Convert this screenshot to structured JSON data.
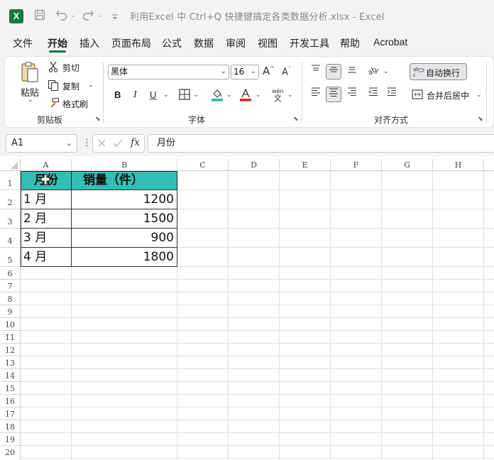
{
  "titlebar": {
    "logo": "X",
    "title": "利用Excel 中 Ctrl+Q 快捷键搞定各类数据分析.xlsx  -  Excel"
  },
  "menu": {
    "tabs": [
      "文件",
      "开始",
      "插入",
      "页面布局",
      "公式",
      "数据",
      "审阅",
      "视图",
      "开发工具",
      "帮助",
      "Acrobat"
    ],
    "active": "开始"
  },
  "clipboard": {
    "paste": "粘贴",
    "cut": "剪切",
    "copy": "复制",
    "format_painter": "格式刷",
    "group_label": "剪贴板"
  },
  "font": {
    "font_name": "黑体",
    "font_size": "16",
    "bold": "B",
    "italic": "I",
    "underline": "U",
    "pinyin": "wén",
    "group_label": "字体",
    "fill_color": "#2bb7a9",
    "font_color": "#e0201b"
  },
  "alignment": {
    "wrap_text": "自动换行",
    "merge_center": "合并后居中",
    "group_label": "对齐方式"
  },
  "formula_bar": {
    "name_box": "A1",
    "fx": "fx",
    "content": "月份"
  },
  "sheet": {
    "columns": [
      "A",
      "B",
      "C",
      "D",
      "E",
      "F",
      "G",
      "H"
    ],
    "rows": [
      "1",
      "2",
      "3",
      "4",
      "5",
      "6",
      "7",
      "8",
      "9",
      "10",
      "11",
      "12",
      "13",
      "14",
      "15",
      "16",
      "17",
      "18",
      "19",
      "20"
    ],
    "header_fill": "#31bfb3",
    "table": {
      "headers": [
        "月份",
        "销量（件）"
      ],
      "rows": [
        [
          "1 月",
          "1200"
        ],
        [
          "2 月",
          "1500"
        ],
        [
          "3 月",
          "900"
        ],
        [
          "4 月",
          "1800"
        ]
      ]
    }
  }
}
